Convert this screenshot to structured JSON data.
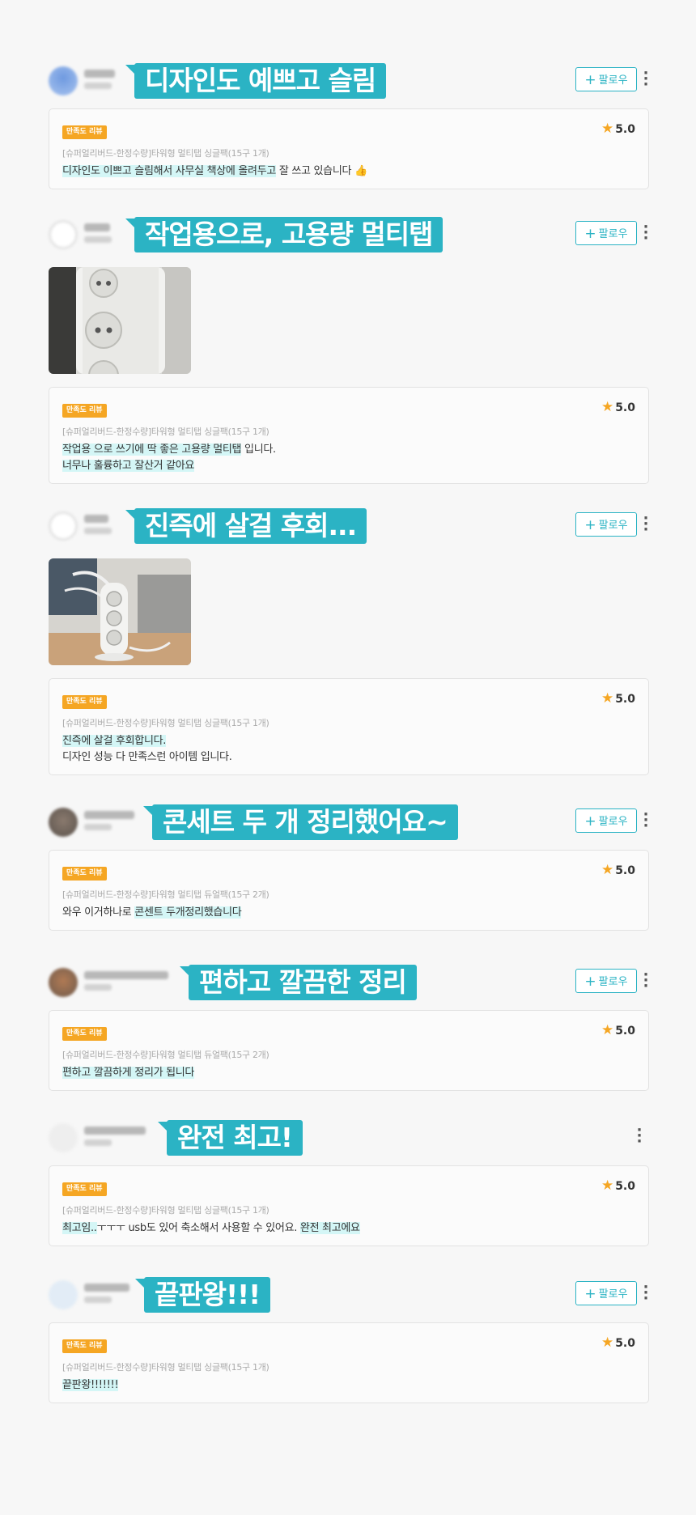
{
  "follow_label": "팔로우",
  "badge_label": "만족도 리뷰",
  "reviews": [
    {
      "bubble": "디자인도 예쁘고 슬림",
      "rating": "5.0",
      "product": "[슈퍼얼리버드-한정수량]타워형 멀티탭 싱글팩(15구 1개)",
      "lines": [
        {
          "hl": "디자인도 이쁘고 슬림해서 사무실 책상에 올려두고",
          "rest": " 잘 쓰고 있습니다 👍"
        }
      ],
      "show_follow": true
    },
    {
      "bubble": "작업용으로, 고용량 멀티탭",
      "rating": "5.0",
      "product": "[슈퍼얼리버드-한정수량]타워형 멀티탭 싱글팩(15구 1개)",
      "lines": [
        {
          "hl": "작업용 으로 쓰기에 딱 좋은 고용량 멀티탭",
          "rest": " 입니다."
        },
        {
          "hl": "너무나 훌륭하고 잘산거 같아요 ",
          "rest": ""
        }
      ],
      "show_follow": true
    },
    {
      "bubble": "진즉에 살걸 후회...",
      "rating": "5.0",
      "product": "[슈퍼얼리버드-한정수량]타워형 멀티탭 싱글팩(15구 1개)",
      "lines": [
        {
          "hl": "진즉에 살걸 후회합니다.",
          "rest": ""
        },
        {
          "hl": "",
          "rest": "디자인 성능 다 만족스런 아이템 입니다."
        }
      ],
      "show_follow": true
    },
    {
      "bubble": "콘세트 두 개 정리했어요~",
      "rating": "5.0",
      "product": "[슈퍼얼리버드-한정수량]타워형 멀티탭 듀얼팩(15구 2개)",
      "lines": [
        {
          "pre": "와우 이거하나로 ",
          "hl": "콘센트 두개정리했습니다",
          "rest": ""
        }
      ],
      "show_follow": true
    },
    {
      "bubble": "편하고 깔끔한 정리",
      "rating": "5.0",
      "product": "[슈퍼얼리버드-한정수량]타워형 멀티탭 듀얼팩(15구 2개)",
      "lines": [
        {
          "hl": "편하고 깔끔하게 정리가 됩니다 ",
          "rest": ""
        }
      ],
      "show_follow": true
    },
    {
      "bubble": "완전 최고!",
      "rating": "5.0",
      "product": "[슈퍼얼리버드-한정수량]타워형 멀티탭 싱글팩(15구 1개)",
      "lines": [
        {
          "hl": "최고임..",
          "rest": "ㅜㅜㅜ usb도 있어 축소해서 사용할 수 있어요. ",
          "hl2": "완전 최고에요"
        }
      ],
      "show_follow": false
    },
    {
      "bubble": "끝판왕!!!",
      "rating": "5.0",
      "product": "[슈퍼얼리버드-한정수량]타워형 멀티탭 싱글팩(15구 1개)",
      "lines": [
        {
          "hl": "끝판왕!!!!!!!",
          "rest": ""
        }
      ],
      "show_follow": true
    }
  ]
}
